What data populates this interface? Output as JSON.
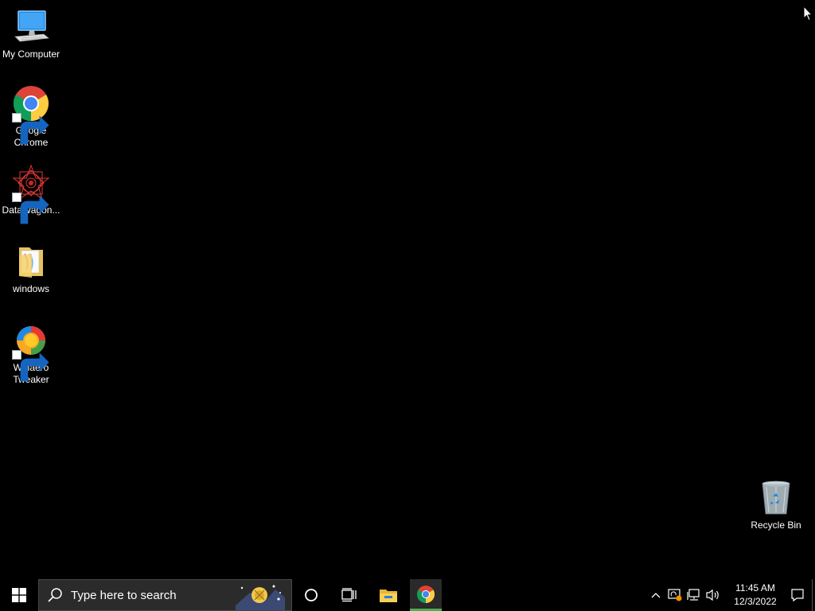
{
  "desktop": {
    "background_color": "#000000",
    "icons": [
      {
        "label": "My Computer",
        "icon": "computer-icon",
        "shortcut": false
      },
      {
        "label": "Google Chrome",
        "icon": "chrome-icon",
        "shortcut": true
      },
      {
        "label": "DataWagon...",
        "icon": "datawagon-icon",
        "shortcut": true
      },
      {
        "label": "windows",
        "icon": "folder-icon",
        "shortcut": false
      },
      {
        "label": "Winaero Tweaker",
        "icon": "winaero-icon",
        "shortcut": true
      },
      {
        "label": "Recycle Bin",
        "icon": "recycle-bin-icon",
        "shortcut": false
      }
    ]
  },
  "taskbar": {
    "search_placeholder": "Type here to search",
    "pinned": [
      {
        "name": "cortana",
        "icon": "cortana-circle-icon"
      },
      {
        "name": "task-view",
        "icon": "task-view-icon"
      },
      {
        "name": "file-explorer",
        "icon": "file-explorer-icon"
      },
      {
        "name": "google-chrome",
        "icon": "chrome-icon",
        "active": true
      }
    ],
    "active_indicator_color": "#4caf50",
    "tray": {
      "icons": [
        "chevron-up-icon",
        "update-warning-icon",
        "network-icon",
        "volume-icon"
      ],
      "time": "11:45 AM",
      "date": "12/3/2022"
    }
  }
}
